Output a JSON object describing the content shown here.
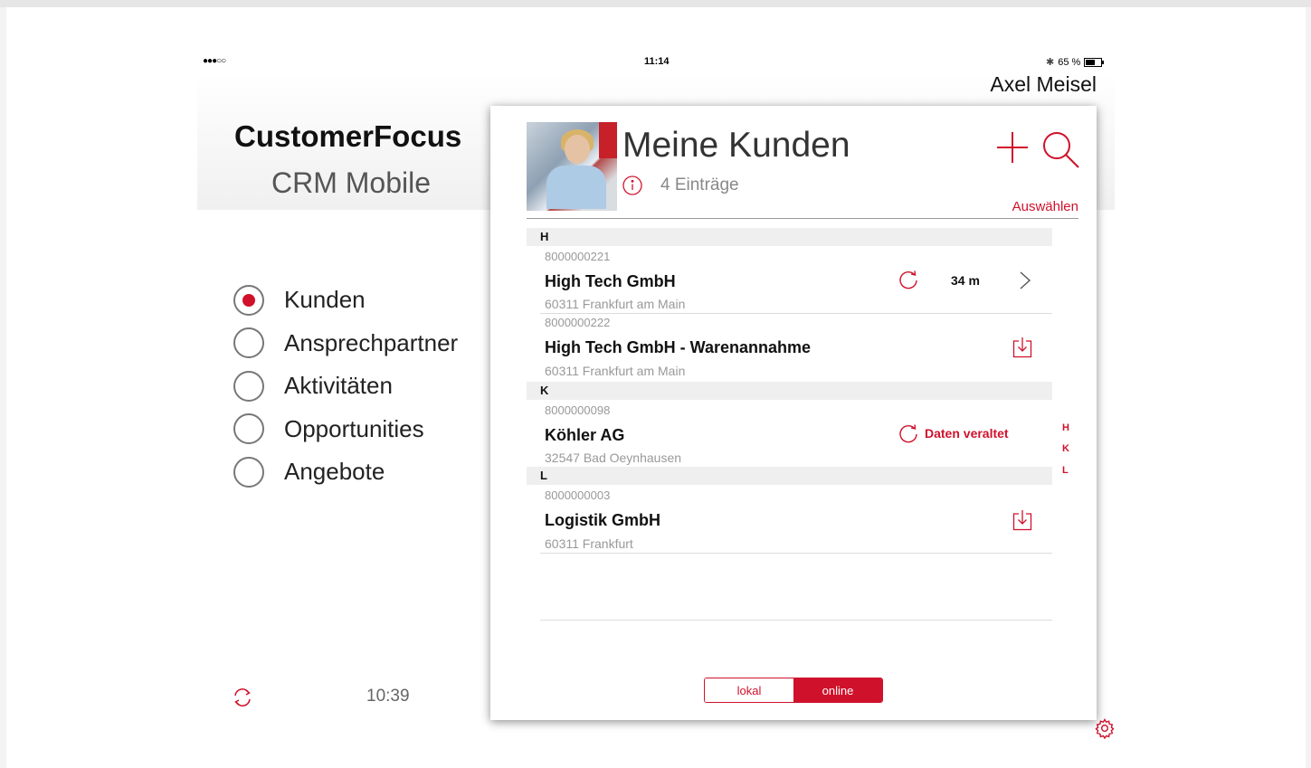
{
  "status_bar": {
    "signal": "●●●○○",
    "time": "11:14",
    "battery": "65 %"
  },
  "user": {
    "name": "Axel Meisel"
  },
  "app": {
    "title": "CustomerFocus",
    "subtitle": "CRM Mobile"
  },
  "nav": {
    "items": [
      {
        "label": "Kunden",
        "selected": true
      },
      {
        "label": "Ansprechpartner",
        "selected": false
      },
      {
        "label": "Aktivitäten",
        "selected": false
      },
      {
        "label": "Opportunities",
        "selected": false
      },
      {
        "label": "Angebote",
        "selected": false
      }
    ]
  },
  "sync": {
    "time": "10:39"
  },
  "panel": {
    "title": "Meine Kunden",
    "entries": "4 Einträge",
    "select_label": "Auswählen",
    "sections": [
      {
        "letter": "H"
      },
      {
        "letter": "K"
      },
      {
        "letter": "L"
      }
    ],
    "rows": [
      {
        "number": "8000000221",
        "name": "High Tech GmbH",
        "address": "60311 Frankfurt am Main",
        "age": "34 m"
      },
      {
        "number": "8000000222",
        "name": "High Tech GmbH - Warenannahme",
        "address": "60311 Frankfurt am Main"
      },
      {
        "number": "8000000098",
        "name": "Köhler AG",
        "address": "32547 Bad Oeynhausen",
        "status": "Daten veraltet"
      },
      {
        "number": "8000000003",
        "name": "Logistik GmbH",
        "address": "60311 Frankfurt"
      }
    ],
    "index": [
      "H",
      "K",
      "L"
    ],
    "segments": {
      "lokal": "lokal",
      "online": "online"
    }
  },
  "colors": {
    "accent": "#d0112b"
  }
}
